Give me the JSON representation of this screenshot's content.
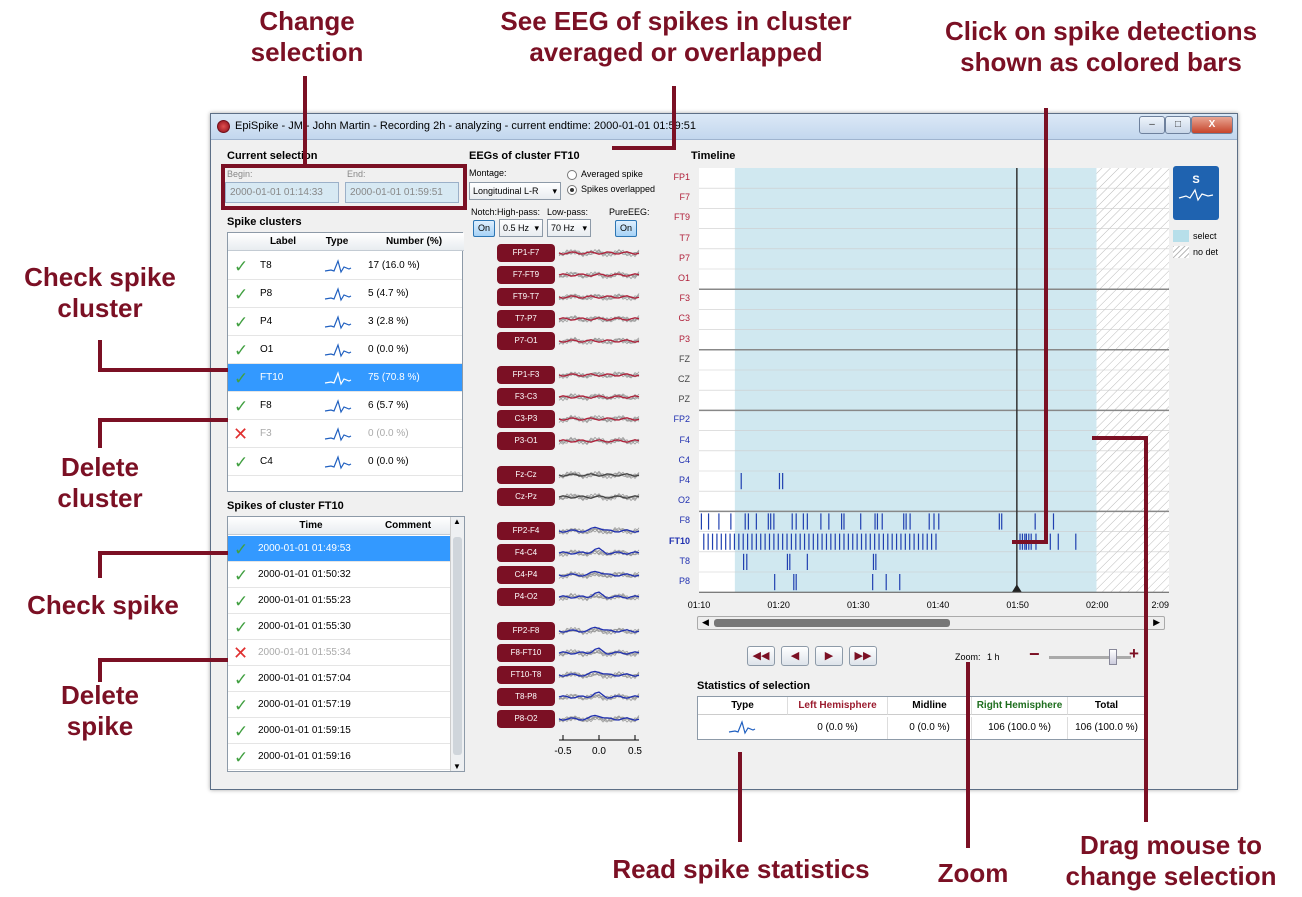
{
  "callouts": {
    "change_selection": "Change\nselection",
    "see_eeg": "See EEG of spikes in cluster\naveraged or overlapped",
    "click_spike": "Click on spike detections\nshown as colored bars",
    "check_cluster": "Check spike\ncluster",
    "delete_cluster": "Delete\ncluster",
    "check_spike": "Check spike",
    "delete_spike": "Delete\nspike",
    "read_stats": "Read spike statistics",
    "zoom": "Zoom",
    "drag_mouse": "Drag mouse to\nchange selection"
  },
  "window": {
    "title": "EpiSpike - JM - John Martin - Recording 2h - analyzing - current endtime: 2000-01-01 01:59:51",
    "buttons": {
      "minimize": "–",
      "maximize": "□",
      "close": "X"
    }
  },
  "current_selection": {
    "heading": "Current selection",
    "begin_label": "Begin:",
    "end_label": "End:",
    "begin": "2000-01-01 01:14:33",
    "end": "2000-01-01 01:59:51"
  },
  "spike_clusters": {
    "heading": "Spike clusters",
    "columns": [
      "Label",
      "Type",
      "Number (%)"
    ],
    "rows": [
      {
        "status": "check",
        "label": "T8",
        "number": "17 (16.0 %)"
      },
      {
        "status": "check",
        "label": "P8",
        "number": "5 (4.7 %)"
      },
      {
        "status": "check",
        "label": "P4",
        "number": "3 (2.8 %)"
      },
      {
        "status": "check",
        "label": "O1",
        "number": "0 (0.0 %)"
      },
      {
        "status": "check",
        "label": "FT10",
        "number": "75 (70.8 %)",
        "selected": true
      },
      {
        "status": "check",
        "label": "F8",
        "number": "6 (5.7 %)"
      },
      {
        "status": "delete",
        "label": "F3",
        "number": "0 (0.0 %)"
      },
      {
        "status": "check",
        "label": "C4",
        "number": "0 (0.0 %)"
      }
    ]
  },
  "spikes_of_cluster": {
    "heading": "Spikes of cluster FT10",
    "columns": [
      "Time",
      "Comment"
    ],
    "rows": [
      {
        "status": "check",
        "time": "2000-01-01 01:49:53",
        "selected": true
      },
      {
        "status": "check",
        "time": "2000-01-01 01:50:32"
      },
      {
        "status": "check",
        "time": "2000-01-01 01:55:23"
      },
      {
        "status": "check",
        "time": "2000-01-01 01:55:30"
      },
      {
        "status": "delete",
        "time": "2000-01-01 01:55:34"
      },
      {
        "status": "check",
        "time": "2000-01-01 01:57:04"
      },
      {
        "status": "check",
        "time": "2000-01-01 01:57:19"
      },
      {
        "status": "check",
        "time": "2000-01-01 01:59:15"
      },
      {
        "status": "check",
        "time": "2000-01-01 01:59:16"
      }
    ]
  },
  "eeg": {
    "heading": "EEGs of cluster FT10",
    "montage_label": "Montage:",
    "montage_value": "Longitudinal L-R",
    "averaged_label": "Averaged spike",
    "overlapped_label": "Spikes overlapped",
    "notch_label": "Notch:",
    "highpass_label": "High-pass:",
    "lowpass_label": "Low-pass:",
    "pureeeg_label": "PureEEG:",
    "notch_value": "On",
    "highpass_value": "0.5 Hz",
    "lowpass_value": "70 Hz",
    "pureeeg_value": "On",
    "groups": [
      {
        "color": "#b0203a",
        "channels": [
          "FP1-F7",
          "F7-FT9",
          "FT9-T7",
          "T7-P7",
          "P7-O1"
        ]
      },
      {
        "color": "#b0203a",
        "channels": [
          "FP1-F3",
          "F3-C3",
          "C3-P3",
          "P3-O1"
        ]
      },
      {
        "color": "#444444",
        "channels": [
          "Fz-Cz",
          "Cz-Pz"
        ]
      },
      {
        "color": "#2030b0",
        "channels": [
          "FP2-F4",
          "F4-C4",
          "C4-P4",
          "P4-O2"
        ]
      },
      {
        "color": "#2030b0",
        "channels": [
          "FP2-F8",
          "F8-FT10",
          "FT10-T8",
          "T8-P8",
          "P8-O2"
        ]
      }
    ],
    "xticks": [
      "-0.5",
      "0.0",
      "0.5"
    ]
  },
  "timeline": {
    "heading": "Timeline",
    "channels": [
      {
        "name": "FP1",
        "color": "#b0203a"
      },
      {
        "name": "F7",
        "color": "#b0203a"
      },
      {
        "name": "FT9",
        "color": "#b0203a"
      },
      {
        "name": "T7",
        "color": "#b0203a"
      },
      {
        "name": "P7",
        "color": "#b0203a"
      },
      {
        "name": "O1",
        "color": "#b0203a"
      },
      {
        "name": "F3",
        "color": "#b0203a"
      },
      {
        "name": "C3",
        "color": "#b0203a"
      },
      {
        "name": "P3",
        "color": "#b0203a"
      },
      {
        "name": "FZ",
        "color": "#444444"
      },
      {
        "name": "CZ",
        "color": "#444444"
      },
      {
        "name": "PZ",
        "color": "#444444"
      },
      {
        "name": "FP2",
        "color": "#2030b0"
      },
      {
        "name": "F4",
        "color": "#2030b0"
      },
      {
        "name": "C4",
        "color": "#2030b0"
      },
      {
        "name": "P4",
        "color": "#2030b0"
      },
      {
        "name": "O2",
        "color": "#2030b0"
      },
      {
        "name": "F8",
        "color": "#2030b0"
      },
      {
        "name": "FT10",
        "color": "#2030b0",
        "bold": true
      },
      {
        "name": "T8",
        "color": "#2030b0"
      },
      {
        "name": "P8",
        "color": "#2030b0"
      }
    ],
    "xticks": [
      "01:10",
      "01:20",
      "01:30",
      "01:40",
      "01:50",
      "02:00",
      "2:09"
    ],
    "legend": {
      "select": "select",
      "no_det": "no det"
    },
    "logo_letter": "S",
    "zoom_label": "Zoom:",
    "zoom_value": "1 h",
    "zoom_level": 0.78
  },
  "statistics": {
    "heading": "Statistics of selection",
    "columns": [
      "Type",
      "Left Hemisphere",
      "Midline",
      "Right Hemisphere",
      "Total"
    ],
    "column_colors": [
      "#000000",
      "#9b1b2e",
      "#000000",
      "#1e6e1e",
      "#000000"
    ],
    "values": [
      "0 (0.0 %)",
      "0 (0.0 %)",
      "106 (100.0 %)",
      "106 (100.0 %)"
    ]
  },
  "colors": {
    "accent": "#7b1024",
    "selection": "#d0e8f0",
    "row_selected": "#3399ff"
  }
}
